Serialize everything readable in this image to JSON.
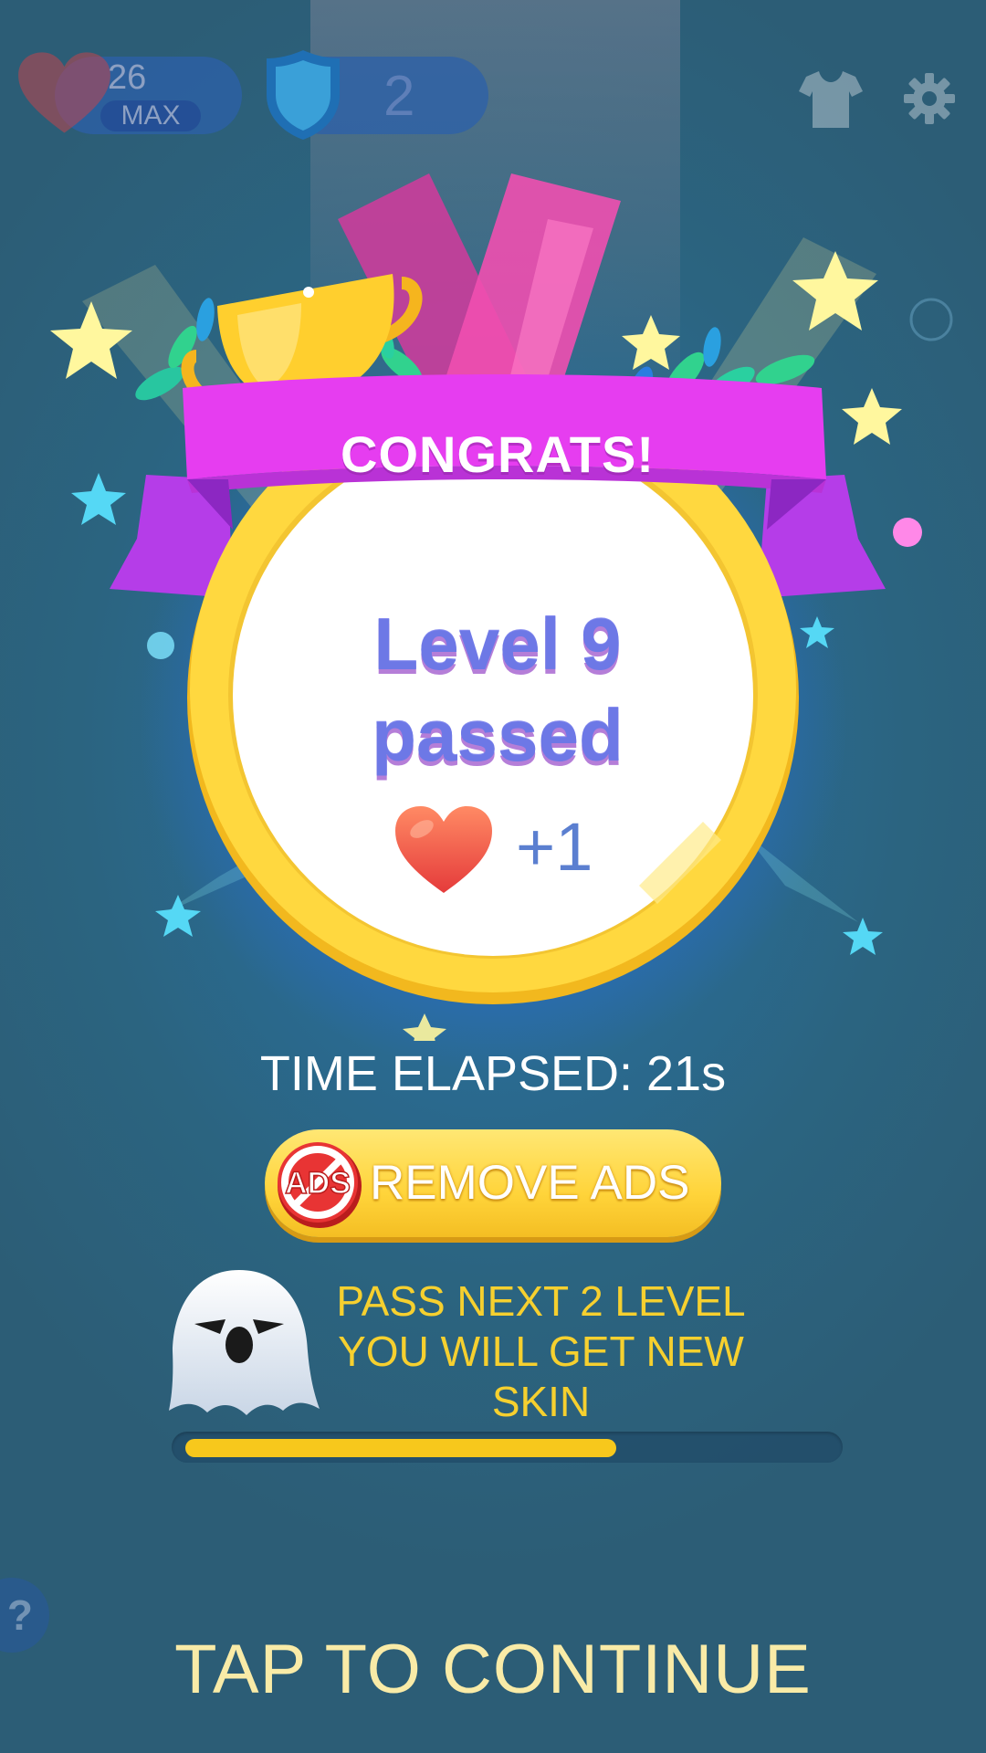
{
  "hud": {
    "lives_count": "26",
    "lives_badge": "MAX",
    "shield_count": "2"
  },
  "medal": {
    "banner": "CONGRATS!",
    "level_line1": "Level 9",
    "level_line2": "passed",
    "reward": "+1"
  },
  "stats": {
    "time_elapsed": "TIME ELAPSED: 21s"
  },
  "remove_ads": {
    "icon_text": "ADS",
    "label": "REMOVE ADS"
  },
  "next_skin": {
    "message": "PASS NEXT 2 LEVEL YOU WILL GET NEW SKIN",
    "progress_fraction": 0.67
  },
  "help_label": "?",
  "footer": {
    "continue_label": "TAP TO CONTINUE"
  },
  "colors": {
    "banner": "#e63df0",
    "ring": "#ffd43a",
    "level_text": "#6d78e6",
    "accent_yellow": "#f6d02f"
  },
  "icons": [
    "heart-icon",
    "shield-icon",
    "shirt-icon",
    "gear-icon",
    "trophy-icon",
    "heart-reward-icon",
    "ads-icon",
    "ghost-icon",
    "help-icon"
  ]
}
